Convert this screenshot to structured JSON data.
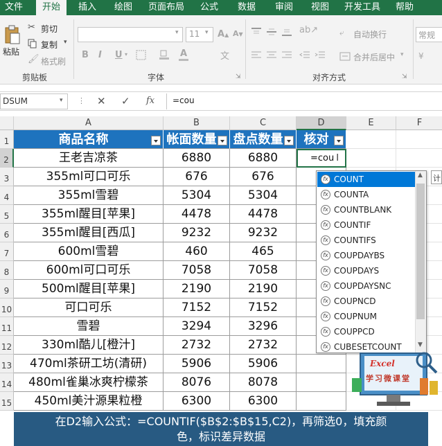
{
  "menu": {
    "tabs": [
      "文件",
      "开始",
      "插入",
      "绘图",
      "页面布局",
      "公式",
      "数据",
      "审阅",
      "视图",
      "开发工具",
      "帮助"
    ],
    "active_tab": "开始"
  },
  "ribbon": {
    "clipboard": {
      "paste": "粘贴",
      "cut": "剪切",
      "copy": "复制",
      "format_painter": "格式刷",
      "title": "剪贴板"
    },
    "font": {
      "size": "11",
      "bold": "B",
      "italic": "I",
      "underline": "U",
      "title": "字体"
    },
    "alignment": {
      "wrap_text": "自动换行",
      "merge_center": "合并后居中",
      "title": "对齐方式"
    },
    "number": {
      "format": "常规"
    }
  },
  "formula_bar": {
    "name_box": "DSUM",
    "fx": "fx",
    "formula": "=cou"
  },
  "sheet": {
    "columns": [
      "A",
      "B",
      "C",
      "D",
      "E",
      "F"
    ],
    "rows": [
      "1",
      "2",
      "3",
      "4",
      "5",
      "6",
      "7",
      "8",
      "9",
      "10",
      "11",
      "12",
      "13",
      "14",
      "15"
    ],
    "headers": [
      "商品名称",
      "帐面数量",
      "盘点数量",
      "核对"
    ],
    "data": [
      [
        "王老吉凉茶",
        "6880",
        "6880"
      ],
      [
        "355ml可口可乐",
        "676",
        "676"
      ],
      [
        "355ml雪碧",
        "5304",
        "5304"
      ],
      [
        "355ml醒目[苹果]",
        "4478",
        "4478"
      ],
      [
        "355ml醒目[西瓜]",
        "9232",
        "9232"
      ],
      [
        "600ml雪碧",
        "460",
        "465"
      ],
      [
        "600ml可口可乐",
        "7058",
        "7058"
      ],
      [
        "500ml醒目[苹果]",
        "2190",
        "2190"
      ],
      [
        "可口可乐",
        "7152",
        "7152"
      ],
      [
        "雪碧",
        "3294",
        "3296"
      ],
      [
        "330ml酷儿[橙汁]",
        "2732",
        "2732"
      ],
      [
        "470ml茶研工坊(清研)",
        "5906",
        "5906"
      ],
      [
        "480ml雀巢冰爽柠檬茶",
        "8076",
        "8078"
      ],
      [
        "450ml美汁源果粒橙",
        "6300",
        "6300"
      ]
    ],
    "active_cell_text": "=cou"
  },
  "autocomplete": {
    "items": [
      "COUNT",
      "COUNTA",
      "COUNTBLANK",
      "COUNTIF",
      "COUNTIFS",
      "COUPDAYBS",
      "COUPDAYS",
      "COUPDAYSNC",
      "COUPNCD",
      "COUPNUM",
      "COUPPCD",
      "CUBESETCOUNT"
    ],
    "selected": "COUNT",
    "tooltip_fragment": "计"
  },
  "logo": {
    "brand": "Excel",
    "tagline": "学习微课堂"
  },
  "caption": {
    "line1": "在D2输入公式：=COUNTIF($B$2:$B$15,C2)，再筛选0，填充颜",
    "line2": "色，标识差异数据"
  },
  "colors": {
    "menu_bg": "#217346",
    "header_fill": "#1e73be",
    "selection": "#0078d7",
    "caption_bg": "#184e78"
  }
}
